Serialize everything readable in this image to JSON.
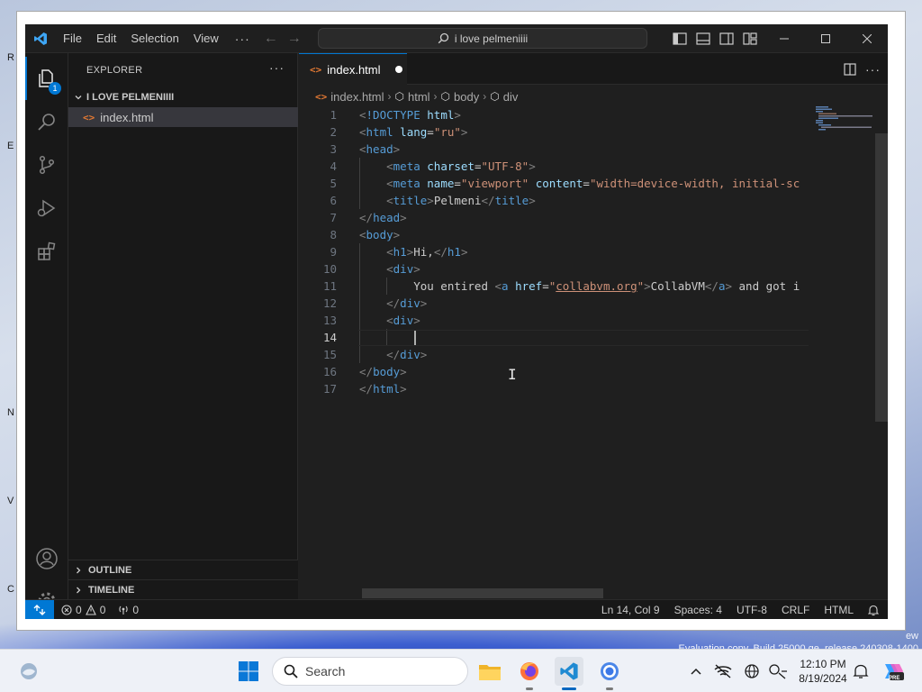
{
  "desktop": {
    "watermark_line1": "ew",
    "watermark_line2": "Evaluation copy. Build 25000.ge_release.240308-1400",
    "edge_letters": [
      "R",
      "E",
      "V",
      "N",
      "C"
    ]
  },
  "titlebar": {
    "menus": [
      "File",
      "Edit",
      "Selection",
      "View"
    ],
    "more": "···",
    "command_center": "i love pelmeniiii",
    "icons": [
      "toggle-primary-sidebar-icon",
      "toggle-panel-icon",
      "toggle-secondary-sidebar-icon",
      "customize-layout-icon"
    ],
    "window_controls": [
      "minimize-icon",
      "maximize-icon",
      "close-icon"
    ]
  },
  "activitybar": {
    "explorer_badge": "1",
    "items": [
      "explorer-icon",
      "search-icon",
      "source-control-icon",
      "run-debug-icon",
      "extensions-icon"
    ],
    "bottom": [
      "accounts-icon",
      "manage-gear-icon"
    ]
  },
  "sidebar": {
    "title": "EXPLORER",
    "more": "···",
    "folder": "I LOVE PELMENIIII",
    "file": "index.html",
    "file_glyph": "<>",
    "sections": [
      "OUTLINE",
      "TIMELINE"
    ]
  },
  "editor": {
    "tab_label": "index.html",
    "breadcrumb": [
      "index.html",
      "html",
      "body",
      "div"
    ],
    "active_line": 14,
    "lines": [
      {
        "n": "1",
        "tokens": [
          [
            "punc",
            "<"
          ],
          [
            "tag",
            "!DOCTYPE "
          ],
          [
            "attr",
            "html"
          ],
          [
            "punc",
            ">"
          ]
        ]
      },
      {
        "n": "2",
        "tokens": [
          [
            "punc",
            "<"
          ],
          [
            "tag",
            "html "
          ],
          [
            "attr",
            "lang"
          ],
          [
            "txt",
            "="
          ],
          [
            "str",
            "\"ru\""
          ],
          [
            "punc",
            ">"
          ]
        ]
      },
      {
        "n": "3",
        "tokens": [
          [
            "punc",
            "<"
          ],
          [
            "tag",
            "head"
          ],
          [
            "punc",
            ">"
          ]
        ]
      },
      {
        "n": "4",
        "tokens": [
          [
            "txt",
            "    "
          ],
          [
            "punc",
            "<"
          ],
          [
            "tag",
            "meta "
          ],
          [
            "attr",
            "charset"
          ],
          [
            "txt",
            "="
          ],
          [
            "str",
            "\"UTF-8\""
          ],
          [
            "punc",
            ">"
          ]
        ]
      },
      {
        "n": "5",
        "tokens": [
          [
            "txt",
            "    "
          ],
          [
            "punc",
            "<"
          ],
          [
            "tag",
            "meta "
          ],
          [
            "attr",
            "name"
          ],
          [
            "txt",
            "="
          ],
          [
            "str",
            "\"viewport\" "
          ],
          [
            "attr",
            "content"
          ],
          [
            "txt",
            "="
          ],
          [
            "str",
            "\"width=device-width, initial-sc"
          ]
        ]
      },
      {
        "n": "6",
        "tokens": [
          [
            "txt",
            "    "
          ],
          [
            "punc",
            "<"
          ],
          [
            "tag",
            "title"
          ],
          [
            "punc",
            ">"
          ],
          [
            "txt",
            "Pelmeni"
          ],
          [
            "punc",
            "</"
          ],
          [
            "tag",
            "title"
          ],
          [
            "punc",
            ">"
          ]
        ]
      },
      {
        "n": "7",
        "tokens": [
          [
            "punc",
            "</"
          ],
          [
            "tag",
            "head"
          ],
          [
            "punc",
            ">"
          ]
        ]
      },
      {
        "n": "8",
        "tokens": [
          [
            "punc",
            "<"
          ],
          [
            "tag",
            "body"
          ],
          [
            "punc",
            ">"
          ]
        ]
      },
      {
        "n": "9",
        "tokens": [
          [
            "txt",
            "    "
          ],
          [
            "punc",
            "<"
          ],
          [
            "tag",
            "h1"
          ],
          [
            "punc",
            ">"
          ],
          [
            "txt",
            "Hi,"
          ],
          [
            "punc",
            "</"
          ],
          [
            "tag",
            "h1"
          ],
          [
            "punc",
            ">"
          ]
        ]
      },
      {
        "n": "10",
        "tokens": [
          [
            "txt",
            "    "
          ],
          [
            "punc",
            "<"
          ],
          [
            "tag",
            "div"
          ],
          [
            "punc",
            ">"
          ]
        ]
      },
      {
        "n": "11",
        "tokens": [
          [
            "txt",
            "        You entired "
          ],
          [
            "punc",
            "<"
          ],
          [
            "tag",
            "a "
          ],
          [
            "attr",
            "href"
          ],
          [
            "txt",
            "="
          ],
          [
            "str",
            "\""
          ],
          [
            "strlink",
            "collabvm.org"
          ],
          [
            "str",
            "\""
          ],
          [
            "punc",
            ">"
          ],
          [
            "txt",
            "CollabVM"
          ],
          [
            "punc",
            "</"
          ],
          [
            "tag",
            "a"
          ],
          [
            "punc",
            ">"
          ],
          [
            "txt",
            " and got i"
          ]
        ]
      },
      {
        "n": "12",
        "tokens": [
          [
            "txt",
            "    "
          ],
          [
            "punc",
            "</"
          ],
          [
            "tag",
            "div"
          ],
          [
            "punc",
            ">"
          ]
        ]
      },
      {
        "n": "13",
        "tokens": [
          [
            "txt",
            "    "
          ],
          [
            "punc",
            "<"
          ],
          [
            "tag",
            "div"
          ],
          [
            "punc",
            ">"
          ]
        ]
      },
      {
        "n": "14",
        "tokens": [
          [
            "txt",
            ""
          ]
        ]
      },
      {
        "n": "15",
        "tokens": [
          [
            "txt",
            "    "
          ],
          [
            "punc",
            "</"
          ],
          [
            "tag",
            "div"
          ],
          [
            "punc",
            ">"
          ]
        ]
      },
      {
        "n": "16",
        "tokens": [
          [
            "punc",
            "</"
          ],
          [
            "tag",
            "body"
          ],
          [
            "punc",
            ">"
          ]
        ]
      },
      {
        "n": "17",
        "tokens": [
          [
            "punc",
            "</"
          ],
          [
            "tag",
            "html"
          ],
          [
            "punc",
            ">"
          ]
        ]
      }
    ]
  },
  "statusbar": {
    "errors": "0",
    "warnings": "0",
    "ports": "0",
    "position": "Ln 14, Col 9",
    "spaces": "Spaces: 4",
    "encoding": "UTF-8",
    "eol": "CRLF",
    "language": "HTML"
  },
  "taskbar": {
    "search_placeholder": "Search",
    "time": "12:10 PM",
    "date": "8/19/2024",
    "apps": [
      "widgets-icon",
      "start-icon",
      "file-explorer-icon",
      "firefox-icon",
      "vscode-icon",
      "chrome-icon"
    ],
    "tray": [
      "show-hidden-icons-chevron",
      "network-off-icon",
      "globe-icon",
      "accessibility-icon",
      "notification-bell-icon",
      "copilot-icon"
    ],
    "copilot_label": "PRE"
  },
  "colors": {
    "accent": "#0078d4",
    "editor_bg": "#1f1f1f",
    "tag": "#569cd6",
    "attr": "#9cdcfe",
    "string": "#ce9178"
  }
}
